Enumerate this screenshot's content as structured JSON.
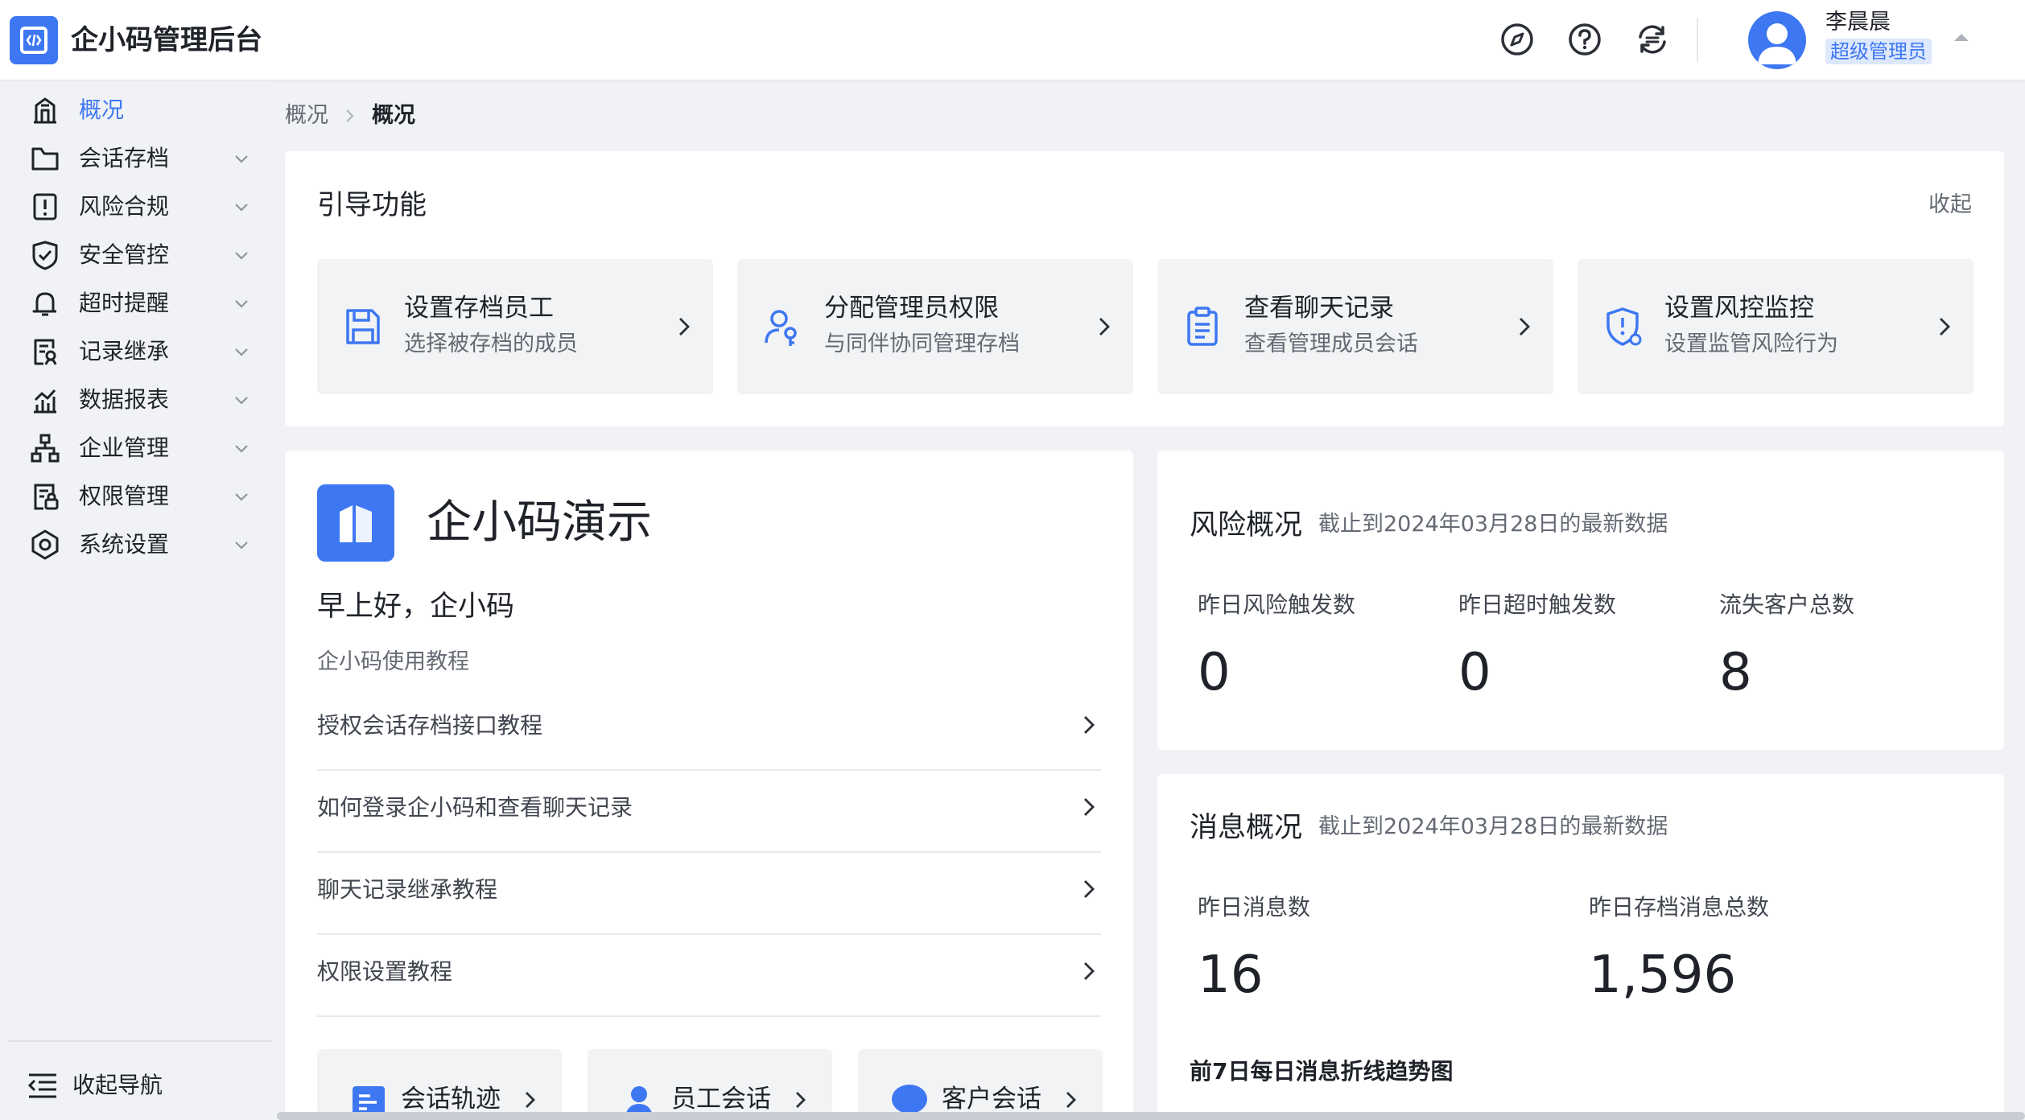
{
  "header": {
    "app_title": "企小码管理后台",
    "user_name": "李晨晨",
    "user_role": "超级管理员",
    "icons": [
      "compass-icon",
      "help-icon",
      "switch-icon"
    ]
  },
  "sidebar": {
    "items": [
      {
        "label": "概况",
        "icon": "building-icon",
        "active": true
      },
      {
        "label": "会话存档",
        "icon": "folder-icon"
      },
      {
        "label": "风险合规",
        "icon": "alert-icon"
      },
      {
        "label": "安全管控",
        "icon": "shield-icon"
      },
      {
        "label": "超时提醒",
        "icon": "bell-icon"
      },
      {
        "label": "记录继承",
        "icon": "record-icon"
      },
      {
        "label": "数据报表",
        "icon": "chart-icon"
      },
      {
        "label": "企业管理",
        "icon": "org-icon"
      },
      {
        "label": "权限管理",
        "icon": "permission-icon"
      },
      {
        "label": "系统设置",
        "icon": "settings-icon"
      }
    ],
    "collapse_label": "收起导航"
  },
  "breadcrumb": {
    "items": [
      "概况",
      "概况"
    ]
  },
  "guide": {
    "title": "引导功能",
    "collapse": "收起",
    "items": [
      {
        "title": "设置存档员工",
        "subtitle": "选择被存档的成员",
        "icon": "save-icon"
      },
      {
        "title": "分配管理员权限",
        "subtitle": "与同伴协同管理存档",
        "icon": "user-key-icon"
      },
      {
        "title": "查看聊天记录",
        "subtitle": "查看管理成员会话",
        "icon": "clipboard-icon"
      },
      {
        "title": "设置风控监控",
        "subtitle": "设置监管风险行为",
        "icon": "shield-alert-icon"
      }
    ]
  },
  "company": {
    "name": "企小码演示",
    "greeting": "早上好，企小码",
    "tutorial_heading": "企小码使用教程",
    "tutorials": [
      "授权会话存档接口教程",
      "如何登录企小码和查看聊天记录",
      "聊天记录继承教程",
      "权限设置教程"
    ],
    "quick_links": [
      {
        "label": "会话轨迹",
        "icon": "track-icon"
      },
      {
        "label": "员工会话",
        "icon": "employee-icon"
      },
      {
        "label": "客户会话",
        "icon": "chat-icon"
      }
    ]
  },
  "risk": {
    "title": "风险概况",
    "subtitle": "截止到2024年03月28日的最新数据",
    "stats": [
      {
        "label": "昨日风险触发数",
        "value": "0"
      },
      {
        "label": "昨日超时触发数",
        "value": "0"
      },
      {
        "label": "流失客户总数",
        "value": "8"
      }
    ]
  },
  "messages": {
    "title": "消息概况",
    "subtitle": "截止到2024年03月28日的最新数据",
    "stats": [
      {
        "label": "昨日消息数",
        "value": "16"
      },
      {
        "label": "昨日存档消息总数",
        "value": "1,596"
      }
    ],
    "trend_label": "前7日每日消息折线趋势图"
  },
  "colors": {
    "accent": "#3d77f2",
    "background": "#f1f2f5",
    "card": "#ffffff",
    "muted": "#646a73"
  }
}
